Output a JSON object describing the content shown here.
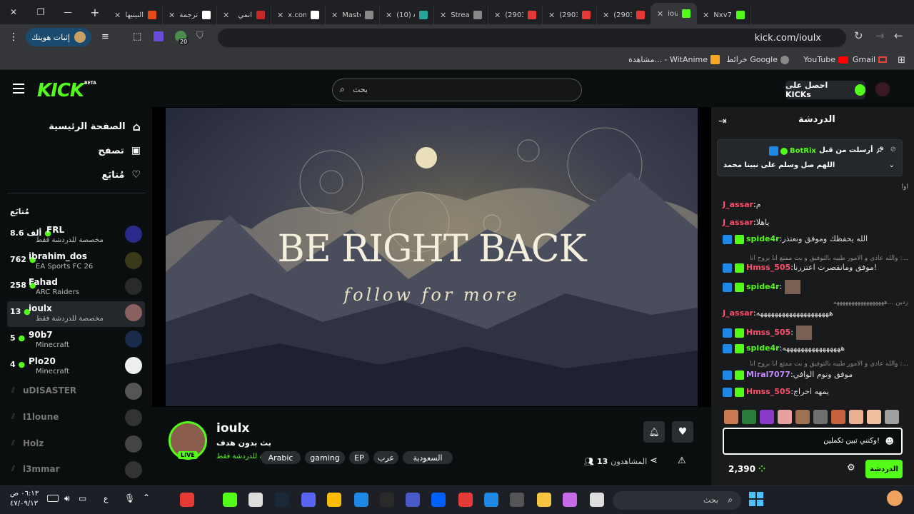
{
  "browser": {
    "tabs": [
      {
        "label": "النينيها",
        "color": "#e64a19"
      },
      {
        "label": "ترجمة",
        "color": "#ffffff"
      },
      {
        "label": "انمي",
        "color": "#c62828"
      },
      {
        "label": "x.com",
        "color": "#ffffff"
      },
      {
        "label": "Maste",
        "color": "#888888"
      },
      {
        "label": "(10) A",
        "color": "#26a69a"
      },
      {
        "label": "Stream",
        "color": "#888888"
      },
      {
        "label": "(2903)",
        "color": "#e53935"
      },
      {
        "label": "(2903)",
        "color": "#e53935"
      },
      {
        "label": "(2903)",
        "color": "#e53935"
      },
      {
        "label": "iou",
        "color": "#53fc18"
      },
      {
        "label": "Nxv7",
        "color": "#53fc18"
      }
    ],
    "url": "kick.com/ioulx",
    "profile_label": "إثبات هويتك",
    "extension_badge": "20",
    "bookmarks": [
      "Gmail",
      "YouTube",
      "خرائط Google",
      "مشاهدة... - WitAnime"
    ]
  },
  "header": {
    "logo": "KICK",
    "logo_sup": "BETA",
    "search_placeholder": "بحث",
    "get_kicks": "احصل على KICKs"
  },
  "sidebar": {
    "nav": [
      {
        "label": "الصفحة الرئيسية",
        "icon": "home-icon"
      },
      {
        "label": "تصفح",
        "icon": "browse-icon"
      },
      {
        "label": "مُتابَع",
        "icon": "heart-icon"
      }
    ],
    "following_title": "مُتابَع",
    "channels": [
      {
        "name": "FRL",
        "count": "8.6 ألف",
        "sub": "مخصصة للدردشة فقط",
        "live": true
      },
      {
        "name": "ibrahim_dos",
        "count": "762",
        "sub": "EA Sports FC 26",
        "live": true
      },
      {
        "name": "Fahad",
        "count": "258",
        "sub": "ARC Raiders",
        "live": true
      },
      {
        "name": "ioulx",
        "count": "13",
        "sub": "مخصصة للدردشة فقط",
        "live": true
      },
      {
        "name": "90b7",
        "count": "5",
        "sub": "Minecraft",
        "live": true
      },
      {
        "name": "Plo20",
        "count": "4",
        "sub": "Minecraft",
        "live": true
      },
      {
        "name": "uDISASTER",
        "count": "",
        "sub": "",
        "live": false
      },
      {
        "name": "I1loune",
        "count": "",
        "sub": "",
        "live": false
      },
      {
        "name": "Holz",
        "count": "",
        "sub": "",
        "live": false
      },
      {
        "name": "l3mmar",
        "count": "",
        "sub": "",
        "live": false
      }
    ]
  },
  "stream": {
    "overlay_title": "BE RIGHT BACK",
    "overlay_sub": "follow for more",
    "channel": "ioulx",
    "title": "بث بدون هدف",
    "category": "مخصصة للدردشة فقط",
    "live_badge": "LIVE",
    "tags": [
      "السعودية",
      "عرب",
      "EP",
      "gaming",
      "Arabic"
    ],
    "viewers": "13",
    "viewers_label": "المشاهدون"
  },
  "chat": {
    "title": "الدردشة",
    "pinned_author": "BotRix",
    "pinned_by": "أرسلت من قبل",
    "pinned_text": "اللهم صل وسلم على نبينا محمد",
    "messages": [
      {
        "user": "",
        "text": "اوا",
        "color": "#aaaaaa"
      },
      {
        "user": "J_assar",
        "text": "م",
        "color": "#ff4d6a"
      },
      {
        "user": "J_assar",
        "text": "ياهلا",
        "color": "#ff4d6a"
      },
      {
        "user": "spide4r",
        "text": "الله يحفظك وموفق ونعتذر",
        "color": "#53fc18"
      },
      {
        "user": "",
        "text": "...: والله عادي و الامور طيبه بالتوفيق و بث ممتع انا بروح انا",
        "color": "#888888"
      },
      {
        "user": "Hmss_505",
        "text": "موفق ومانقصرت اعتزرنا!",
        "color": "#ff4d6a"
      },
      {
        "user": "spide4r",
        "text": "",
        "color": "#53fc18"
      },
      {
        "user": "",
        "text": "ردين ...هههههههههههههههههه",
        "color": "#888888"
      },
      {
        "user": "J_assar",
        "text": "ههههههههههههههههههههه",
        "color": "#ff4d6a"
      },
      {
        "user": "Hmss_505",
        "text": "",
        "color": "#ff4d6a"
      },
      {
        "user": "spide4r",
        "text": "ههههههههههههههههه",
        "color": "#53fc18"
      },
      {
        "user": "",
        "text": "...: والله عادي و الامور طيبه بالتوفيق و بث ممتع انا بروح انا",
        "color": "#888888"
      },
      {
        "user": "Miral7077",
        "text": "موفق ونوم الوافي",
        "color": "#c58cff"
      },
      {
        "user": "Hmss_505",
        "text": "يمهه احراج",
        "color": "#ff4d6a"
      }
    ],
    "input_value": "وكنني تبين تكملين!",
    "points": "2,390",
    "send_label": "الدردشة"
  },
  "taskbar": {
    "search": "بحث",
    "time": "٠٦:١٣ ص",
    "date": "٤٧/٠٩/١٣",
    "lang": "ع"
  }
}
